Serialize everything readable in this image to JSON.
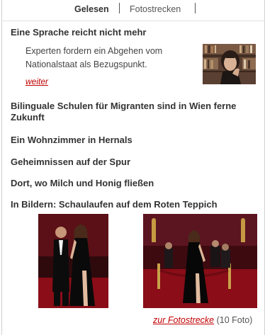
{
  "tabs": {
    "active": "Gelesen",
    "inactive": "Fotostrecken"
  },
  "featured": {
    "headline": "Eine Sprache reicht nicht mehr",
    "teaser": "Experten fordern ein Abgehen vom Nationalstaat als Bezugspunkt.",
    "more_label": "weiter",
    "image_icon": "portrait-photo"
  },
  "headlines": [
    "Bilinguale Schulen für Migranten sind in Wien ferne Zukunft",
    "Ein Wohnzimmer in Hernals",
    "Geheimnissen auf der Spur",
    "Dort, wo Milch und Honig fließen",
    "In Bildern: Schaulaufen auf dem Roten Teppich"
  ],
  "gallery": {
    "link_label": "zur Fotostrecke",
    "count_label": "(10 Foto)",
    "images": [
      "red-carpet-couple-photo",
      "red-carpet-actress-photo"
    ]
  },
  "colors": {
    "link": "#c00000",
    "text": "#333333",
    "carpet": "#8a0d17"
  }
}
